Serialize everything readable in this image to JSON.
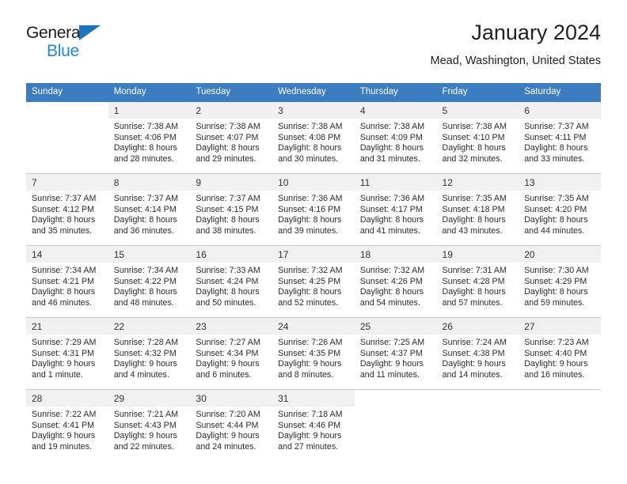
{
  "logo": {
    "word_one": "General",
    "word_two": "Blue",
    "triangle_icon": "triangle-icon",
    "accent_dark": "#1b1b1b",
    "accent_blue": "#1e88d8",
    "triangle_blue": "#1e73be"
  },
  "header": {
    "title": "January 2024",
    "subtitle": "Mead, Washington, United States"
  },
  "colors": {
    "header_bar": "#3b7dc0",
    "daynum_strip": "#f0f0f0",
    "separator": "#c9c9c9",
    "text": "#2b2b2b"
  },
  "weekday_headers": [
    "Sunday",
    "Monday",
    "Tuesday",
    "Wednesday",
    "Thursday",
    "Friday",
    "Saturday"
  ],
  "labels": {
    "sunrise_prefix": "Sunrise:",
    "sunset_prefix": "Sunset:",
    "daylight_prefix": "Daylight:"
  },
  "weeks": [
    [
      {
        "day": "",
        "blank": true,
        "line1": "",
        "line2": "",
        "line3": "",
        "line4": ""
      },
      {
        "day": "1",
        "line1": "Sunrise: 7:38 AM",
        "line2": "Sunset: 4:06 PM",
        "line3": "Daylight: 8 hours",
        "line4": "and 28 minutes."
      },
      {
        "day": "2",
        "line1": "Sunrise: 7:38 AM",
        "line2": "Sunset: 4:07 PM",
        "line3": "Daylight: 8 hours",
        "line4": "and 29 minutes."
      },
      {
        "day": "3",
        "line1": "Sunrise: 7:38 AM",
        "line2": "Sunset: 4:08 PM",
        "line3": "Daylight: 8 hours",
        "line4": "and 30 minutes."
      },
      {
        "day": "4",
        "line1": "Sunrise: 7:38 AM",
        "line2": "Sunset: 4:09 PM",
        "line3": "Daylight: 8 hours",
        "line4": "and 31 minutes."
      },
      {
        "day": "5",
        "line1": "Sunrise: 7:38 AM",
        "line2": "Sunset: 4:10 PM",
        "line3": "Daylight: 8 hours",
        "line4": "and 32 minutes."
      },
      {
        "day": "6",
        "line1": "Sunrise: 7:37 AM",
        "line2": "Sunset: 4:11 PM",
        "line3": "Daylight: 8 hours",
        "line4": "and 33 minutes."
      }
    ],
    [
      {
        "day": "7",
        "line1": "Sunrise: 7:37 AM",
        "line2": "Sunset: 4:12 PM",
        "line3": "Daylight: 8 hours",
        "line4": "and 35 minutes."
      },
      {
        "day": "8",
        "line1": "Sunrise: 7:37 AM",
        "line2": "Sunset: 4:14 PM",
        "line3": "Daylight: 8 hours",
        "line4": "and 36 minutes."
      },
      {
        "day": "9",
        "line1": "Sunrise: 7:37 AM",
        "line2": "Sunset: 4:15 PM",
        "line3": "Daylight: 8 hours",
        "line4": "and 38 minutes."
      },
      {
        "day": "10",
        "line1": "Sunrise: 7:36 AM",
        "line2": "Sunset: 4:16 PM",
        "line3": "Daylight: 8 hours",
        "line4": "and 39 minutes."
      },
      {
        "day": "11",
        "line1": "Sunrise: 7:36 AM",
        "line2": "Sunset: 4:17 PM",
        "line3": "Daylight: 8 hours",
        "line4": "and 41 minutes."
      },
      {
        "day": "12",
        "line1": "Sunrise: 7:35 AM",
        "line2": "Sunset: 4:18 PM",
        "line3": "Daylight: 8 hours",
        "line4": "and 43 minutes."
      },
      {
        "day": "13",
        "line1": "Sunrise: 7:35 AM",
        "line2": "Sunset: 4:20 PM",
        "line3": "Daylight: 8 hours",
        "line4": "and 44 minutes."
      }
    ],
    [
      {
        "day": "14",
        "line1": "Sunrise: 7:34 AM",
        "line2": "Sunset: 4:21 PM",
        "line3": "Daylight: 8 hours",
        "line4": "and 46 minutes."
      },
      {
        "day": "15",
        "line1": "Sunrise: 7:34 AM",
        "line2": "Sunset: 4:22 PM",
        "line3": "Daylight: 8 hours",
        "line4": "and 48 minutes."
      },
      {
        "day": "16",
        "line1": "Sunrise: 7:33 AM",
        "line2": "Sunset: 4:24 PM",
        "line3": "Daylight: 8 hours",
        "line4": "and 50 minutes."
      },
      {
        "day": "17",
        "line1": "Sunrise: 7:32 AM",
        "line2": "Sunset: 4:25 PM",
        "line3": "Daylight: 8 hours",
        "line4": "and 52 minutes."
      },
      {
        "day": "18",
        "line1": "Sunrise: 7:32 AM",
        "line2": "Sunset: 4:26 PM",
        "line3": "Daylight: 8 hours",
        "line4": "and 54 minutes."
      },
      {
        "day": "19",
        "line1": "Sunrise: 7:31 AM",
        "line2": "Sunset: 4:28 PM",
        "line3": "Daylight: 8 hours",
        "line4": "and 57 minutes."
      },
      {
        "day": "20",
        "line1": "Sunrise: 7:30 AM",
        "line2": "Sunset: 4:29 PM",
        "line3": "Daylight: 8 hours",
        "line4": "and 59 minutes."
      }
    ],
    [
      {
        "day": "21",
        "line1": "Sunrise: 7:29 AM",
        "line2": "Sunset: 4:31 PM",
        "line3": "Daylight: 9 hours",
        "line4": "and 1 minute."
      },
      {
        "day": "22",
        "line1": "Sunrise: 7:28 AM",
        "line2": "Sunset: 4:32 PM",
        "line3": "Daylight: 9 hours",
        "line4": "and 4 minutes."
      },
      {
        "day": "23",
        "line1": "Sunrise: 7:27 AM",
        "line2": "Sunset: 4:34 PM",
        "line3": "Daylight: 9 hours",
        "line4": "and 6 minutes."
      },
      {
        "day": "24",
        "line1": "Sunrise: 7:26 AM",
        "line2": "Sunset: 4:35 PM",
        "line3": "Daylight: 9 hours",
        "line4": "and 8 minutes."
      },
      {
        "day": "25",
        "line1": "Sunrise: 7:25 AM",
        "line2": "Sunset: 4:37 PM",
        "line3": "Daylight: 9 hours",
        "line4": "and 11 minutes."
      },
      {
        "day": "26",
        "line1": "Sunrise: 7:24 AM",
        "line2": "Sunset: 4:38 PM",
        "line3": "Daylight: 9 hours",
        "line4": "and 14 minutes."
      },
      {
        "day": "27",
        "line1": "Sunrise: 7:23 AM",
        "line2": "Sunset: 4:40 PM",
        "line3": "Daylight: 9 hours",
        "line4": "and 16 minutes."
      }
    ],
    [
      {
        "day": "28",
        "line1": "Sunrise: 7:22 AM",
        "line2": "Sunset: 4:41 PM",
        "line3": "Daylight: 9 hours",
        "line4": "and 19 minutes."
      },
      {
        "day": "29",
        "line1": "Sunrise: 7:21 AM",
        "line2": "Sunset: 4:43 PM",
        "line3": "Daylight: 9 hours",
        "line4": "and 22 minutes."
      },
      {
        "day": "30",
        "line1": "Sunrise: 7:20 AM",
        "line2": "Sunset: 4:44 PM",
        "line3": "Daylight: 9 hours",
        "line4": "and 24 minutes."
      },
      {
        "day": "31",
        "line1": "Sunrise: 7:18 AM",
        "line2": "Sunset: 4:46 PM",
        "line3": "Daylight: 9 hours",
        "line4": "and 27 minutes."
      },
      {
        "day": "",
        "blank": true,
        "line1": "",
        "line2": "",
        "line3": "",
        "line4": ""
      },
      {
        "day": "",
        "blank": true,
        "line1": "",
        "line2": "",
        "line3": "",
        "line4": ""
      },
      {
        "day": "",
        "blank": true,
        "line1": "",
        "line2": "",
        "line3": "",
        "line4": ""
      }
    ]
  ]
}
